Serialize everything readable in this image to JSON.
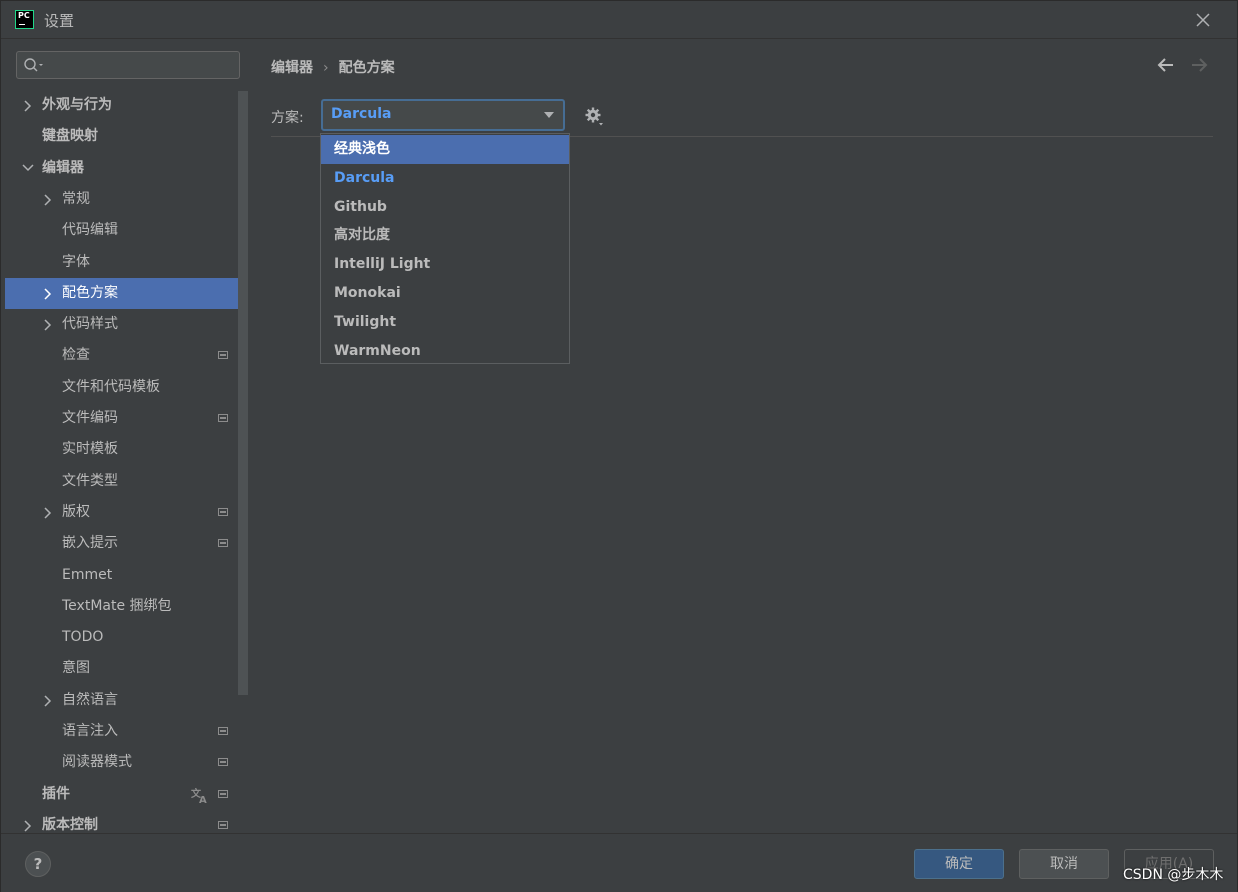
{
  "window": {
    "title": "设置",
    "app_icon_text": "PC"
  },
  "sidebar": {
    "search_placeholder": "",
    "items": [
      {
        "label": "外观与行为",
        "level": 0,
        "chevron": "right",
        "bold": true,
        "badge": false
      },
      {
        "label": "键盘映射",
        "level": 0,
        "chevron": "none",
        "bold": true,
        "badge": false
      },
      {
        "label": "编辑器",
        "level": 0,
        "chevron": "down",
        "bold": true,
        "badge": false
      },
      {
        "label": "常规",
        "level": 1,
        "chevron": "right",
        "bold": false,
        "badge": false
      },
      {
        "label": "代码编辑",
        "level": 1,
        "chevron": "none",
        "bold": false,
        "badge": false
      },
      {
        "label": "字体",
        "level": 1,
        "chevron": "none",
        "bold": false,
        "badge": false
      },
      {
        "label": "配色方案",
        "level": 1,
        "chevron": "right",
        "bold": false,
        "badge": false,
        "selected": true
      },
      {
        "label": "代码样式",
        "level": 1,
        "chevron": "right",
        "bold": false,
        "badge": false
      },
      {
        "label": "检查",
        "level": 1,
        "chevron": "none",
        "bold": false,
        "badge": true
      },
      {
        "label": "文件和代码模板",
        "level": 1,
        "chevron": "none",
        "bold": false,
        "badge": false
      },
      {
        "label": "文件编码",
        "level": 1,
        "chevron": "none",
        "bold": false,
        "badge": true
      },
      {
        "label": "实时模板",
        "level": 1,
        "chevron": "none",
        "bold": false,
        "badge": false
      },
      {
        "label": "文件类型",
        "level": 1,
        "chevron": "none",
        "bold": false,
        "badge": false
      },
      {
        "label": "版权",
        "level": 1,
        "chevron": "right",
        "bold": false,
        "badge": true
      },
      {
        "label": "嵌入提示",
        "level": 1,
        "chevron": "none",
        "bold": false,
        "badge": true
      },
      {
        "label": "Emmet",
        "level": 1,
        "chevron": "none",
        "bold": false,
        "badge": false
      },
      {
        "label": "TextMate 捆绑包",
        "level": 1,
        "chevron": "none",
        "bold": false,
        "badge": false
      },
      {
        "label": "TODO",
        "level": 1,
        "chevron": "none",
        "bold": false,
        "badge": false
      },
      {
        "label": "意图",
        "level": 1,
        "chevron": "none",
        "bold": false,
        "badge": false
      },
      {
        "label": "自然语言",
        "level": 1,
        "chevron": "right",
        "bold": false,
        "badge": false
      },
      {
        "label": "语言注入",
        "level": 1,
        "chevron": "none",
        "bold": false,
        "badge": true
      },
      {
        "label": "阅读器模式",
        "level": 1,
        "chevron": "none",
        "bold": false,
        "badge": true
      },
      {
        "label": "插件",
        "level": 0,
        "chevron": "none",
        "bold": true,
        "badge": true,
        "translate": true
      },
      {
        "label": "版本控制",
        "level": 0,
        "chevron": "right",
        "bold": true,
        "badge": true
      }
    ]
  },
  "main": {
    "breadcrumb": [
      "编辑器",
      "配色方案"
    ],
    "breadcrumb_separator": "›",
    "scheme_label": "方案:",
    "scheme_selected": "Darcula",
    "scheme_options": [
      {
        "label": "经典浅色",
        "state": "hover"
      },
      {
        "label": "Darcula",
        "state": "current"
      },
      {
        "label": "Github",
        "state": ""
      },
      {
        "label": "高对比度",
        "state": ""
      },
      {
        "label": "IntelliJ Light",
        "state": ""
      },
      {
        "label": "Monokai",
        "state": ""
      },
      {
        "label": "Twilight",
        "state": ""
      },
      {
        "label": "WarmNeon",
        "state": ""
      }
    ]
  },
  "footer": {
    "help_label": "?",
    "ok_label": "确定",
    "cancel_label": "取消",
    "apply_label": "应用(A)"
  },
  "watermark": "CSDN @步木木",
  "colors": {
    "accent": "#4b6eaf",
    "link": "#589df6",
    "background": "#3c3f41"
  },
  "icons": {
    "close": "close-icon",
    "search": "search-icon",
    "back": "arrow-left-icon",
    "forward": "arrow-right-icon",
    "gear": "gear-icon"
  }
}
